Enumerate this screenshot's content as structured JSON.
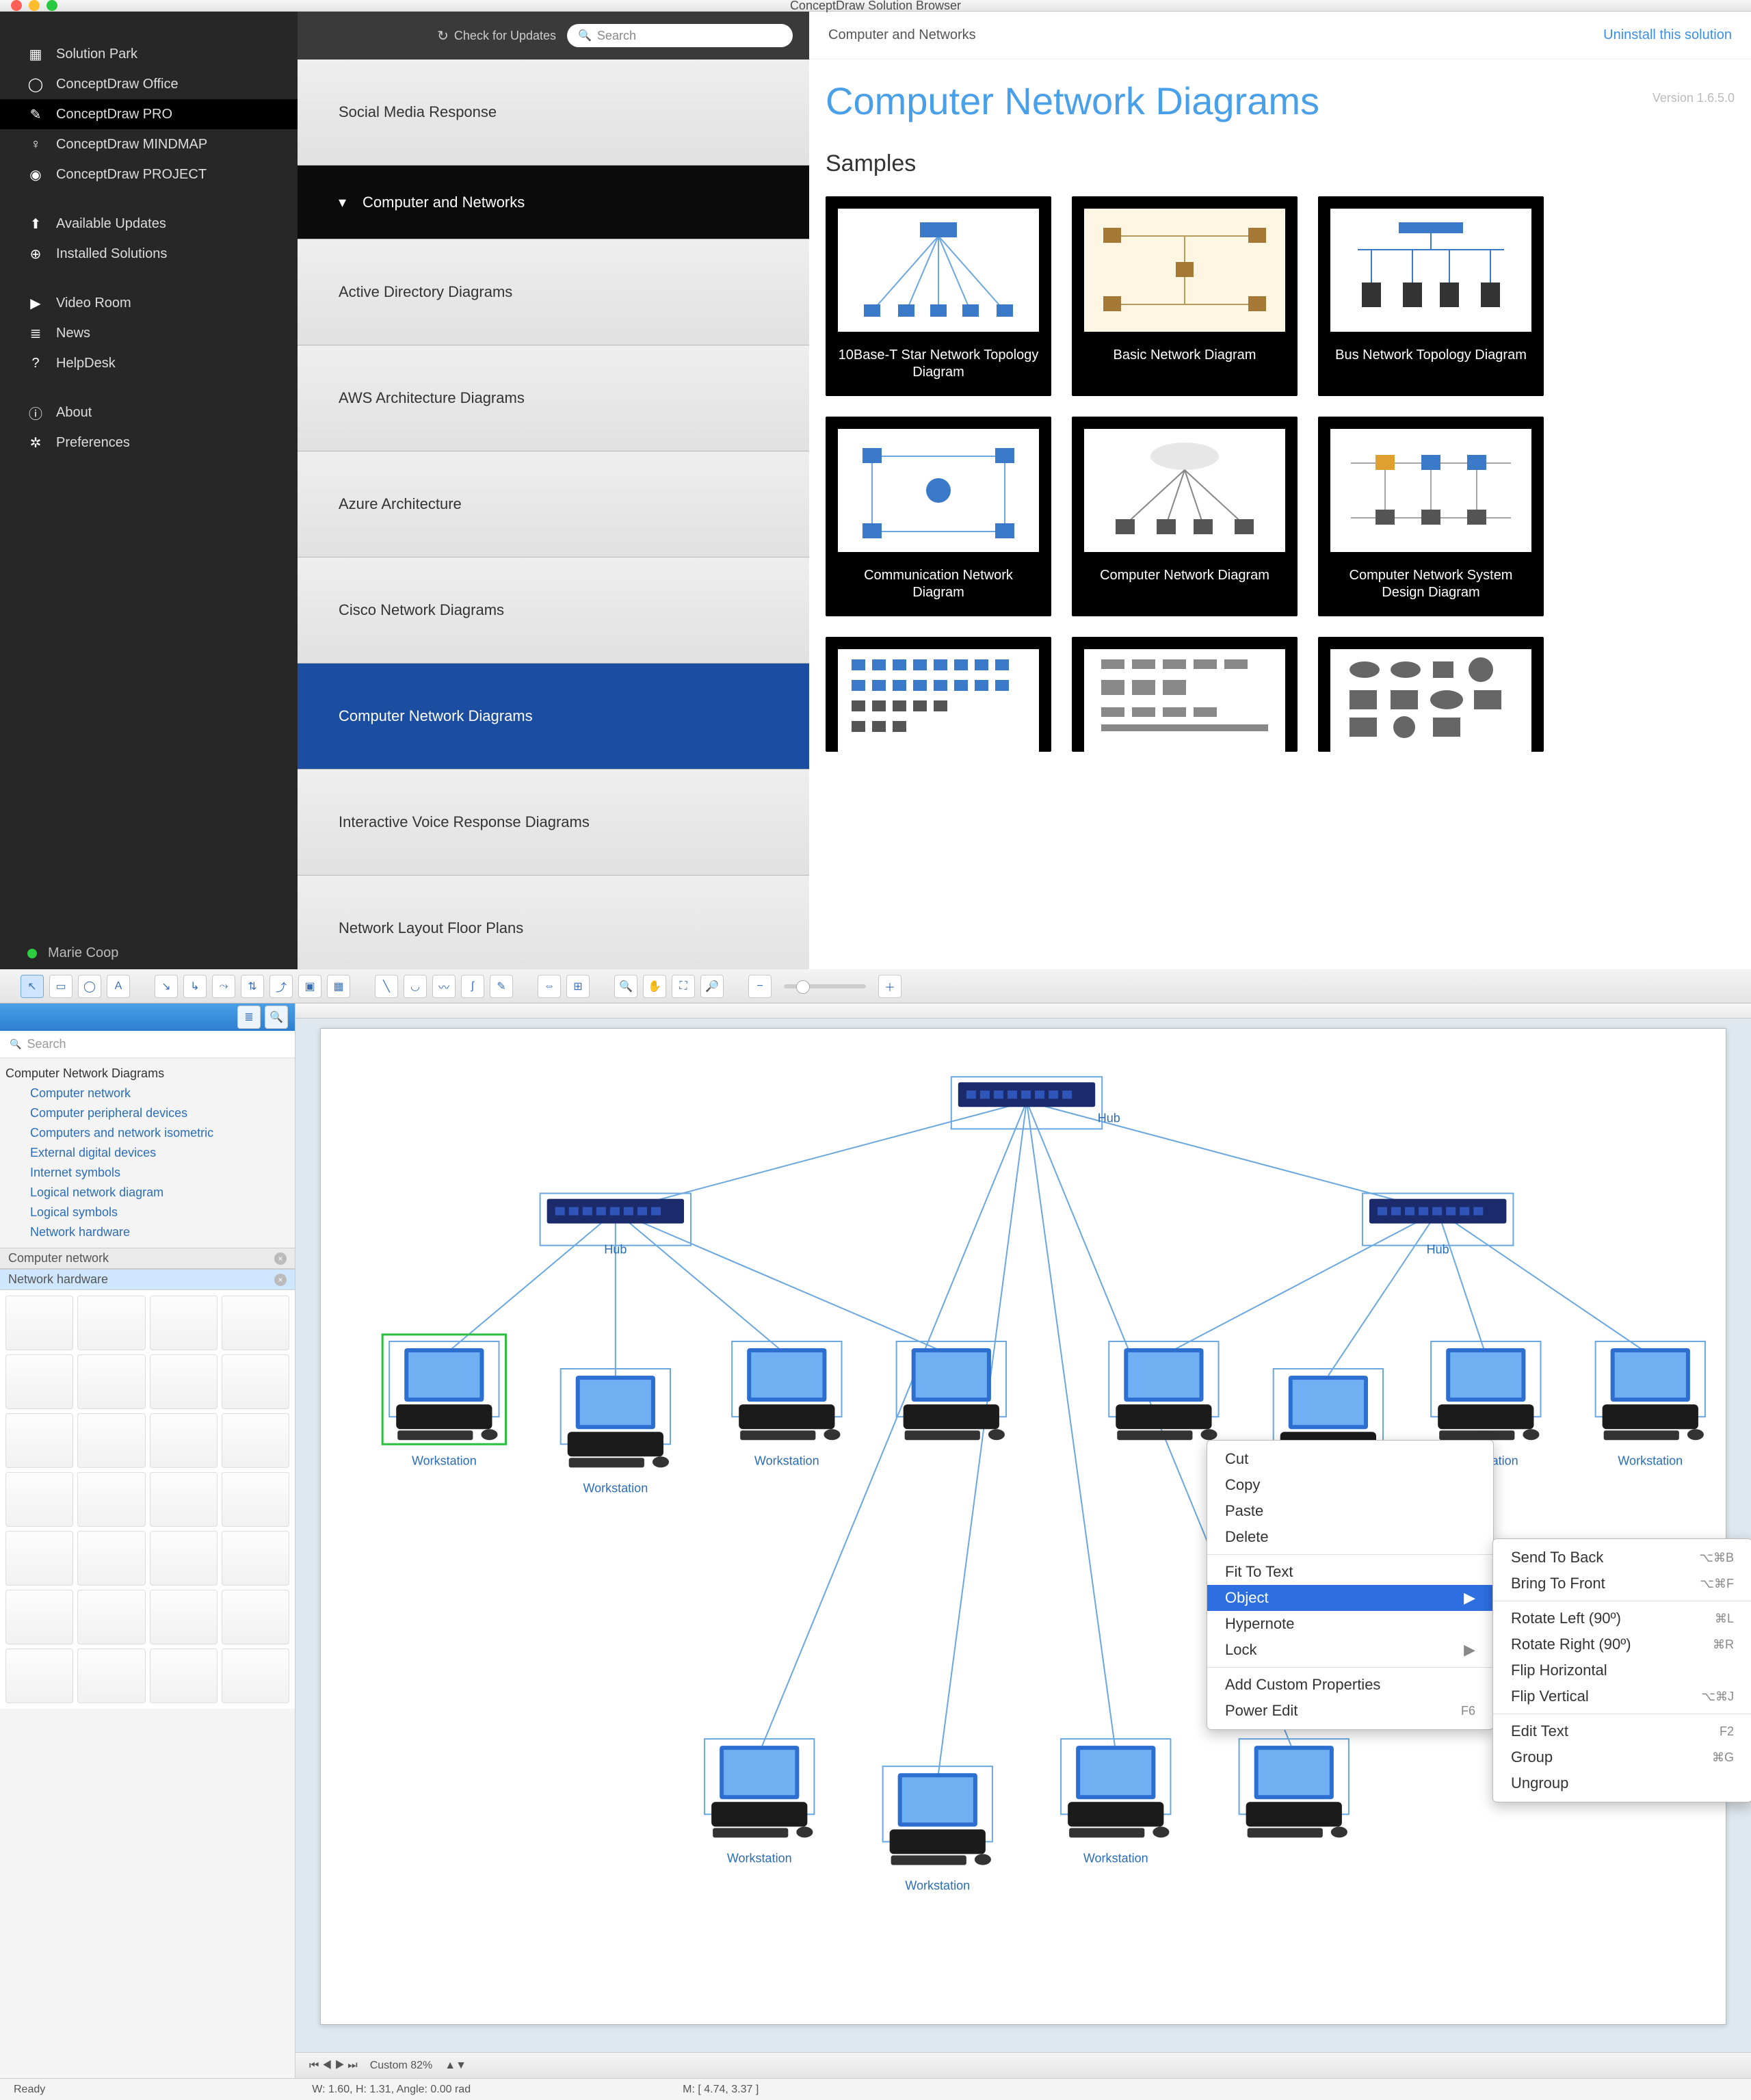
{
  "titlebar": {
    "title": "ConceptDraw Solution Browser"
  },
  "left_nav": {
    "items": [
      {
        "label": "Solution Park",
        "icon": "grid"
      },
      {
        "label": "ConceptDraw Office",
        "icon": "ring"
      },
      {
        "label": "ConceptDraw PRO",
        "icon": "pencil",
        "selected": true
      },
      {
        "label": "ConceptDraw MINDMAP",
        "icon": "bulb"
      },
      {
        "label": "ConceptDraw PROJECT",
        "icon": "target"
      }
    ],
    "section2": [
      {
        "label": "Available Updates",
        "icon": "download"
      },
      {
        "label": "Installed Solutions",
        "icon": "down-circle"
      }
    ],
    "section3": [
      {
        "label": "Video Room",
        "icon": "play"
      },
      {
        "label": "News",
        "icon": "list"
      },
      {
        "label": "HelpDesk",
        "icon": "question"
      }
    ],
    "section4": [
      {
        "label": "About",
        "icon": "info"
      },
      {
        "label": "Preferences",
        "icon": "gear"
      }
    ],
    "user": "Marie Coop"
  },
  "mid": {
    "check_updates": "Check for Updates",
    "search_placeholder": "Search",
    "cells": [
      {
        "label": "Social Media Response",
        "type": "item"
      },
      {
        "label": "Computer and Networks",
        "type": "category"
      },
      {
        "label": "Active Directory Diagrams",
        "type": "item"
      },
      {
        "label": "AWS Architecture Diagrams",
        "type": "item"
      },
      {
        "label": "Azure Architecture",
        "type": "item"
      },
      {
        "label": "Cisco Network Diagrams",
        "type": "item"
      },
      {
        "label": "Computer Network Diagrams",
        "type": "item",
        "selected": true
      },
      {
        "label": "Interactive Voice Response Diagrams",
        "type": "item"
      },
      {
        "label": "Network Layout Floor Plans",
        "type": "item"
      }
    ]
  },
  "right": {
    "breadcrumb": "Computer and Networks",
    "uninstall": "Uninstall this solution",
    "title": "Computer Network Diagrams",
    "version": "Version 1.6.5.0",
    "samples_label": "Samples",
    "samples": [
      "10Base-T Star Network Topology Diagram",
      "Basic Network Diagram",
      "Bus Network Topology Diagram",
      "Communication Network Diagram",
      "Computer Network Diagram",
      "Computer Network System Design Diagram"
    ]
  },
  "editor": {
    "lib_search_placeholder": "Search",
    "tree_root": "Computer Network Diagrams",
    "tree_children": [
      "Computer network",
      "Computer peripheral devices",
      "Computers and network isometric",
      "External digital devices",
      "Internet symbols",
      "Logical network diagram",
      "Logical symbols",
      "Network hardware"
    ],
    "lib_headers": [
      {
        "label": "Computer network"
      },
      {
        "label": "Network hardware",
        "selected": true
      }
    ],
    "node_labels": {
      "hub": "Hub",
      "workstation": "Workstation"
    },
    "ctx": {
      "cut": "Cut",
      "copy": "Copy",
      "paste": "Paste",
      "delete": "Delete",
      "fit": "Fit To Text",
      "object": "Object",
      "hyper": "Hypernote",
      "lock": "Lock",
      "props": "Add Custom Properties",
      "pedit": "Power Edit",
      "pedit_sc": "F6"
    },
    "sub": {
      "back": "Send To Back",
      "back_sc": "⌥⌘B",
      "front": "Bring To Front",
      "front_sc": "⌥⌘F",
      "rl": "Rotate Left (90º)",
      "rl_sc": "⌘L",
      "rr": "Rotate Right (90º)",
      "rr_sc": "⌘R",
      "fh": "Flip Horizontal",
      "fv": "Flip Vertical",
      "fv_sc": "⌥⌘J",
      "et": "Edit Text",
      "et_sc": "F2",
      "grp": "Group",
      "grp_sc": "⌘G",
      "ugrp": "Ungroup"
    },
    "bottombar": {
      "zoom_label": "Custom 82%",
      "nav": "⏮ ◀ ▶ ⏭"
    },
    "status": {
      "ready": "Ready",
      "dims": "W: 1.60,  H: 1.31,  Angle: 0.00 rad",
      "mouse": "M: [ 4.74, 3.37 ]"
    }
  }
}
